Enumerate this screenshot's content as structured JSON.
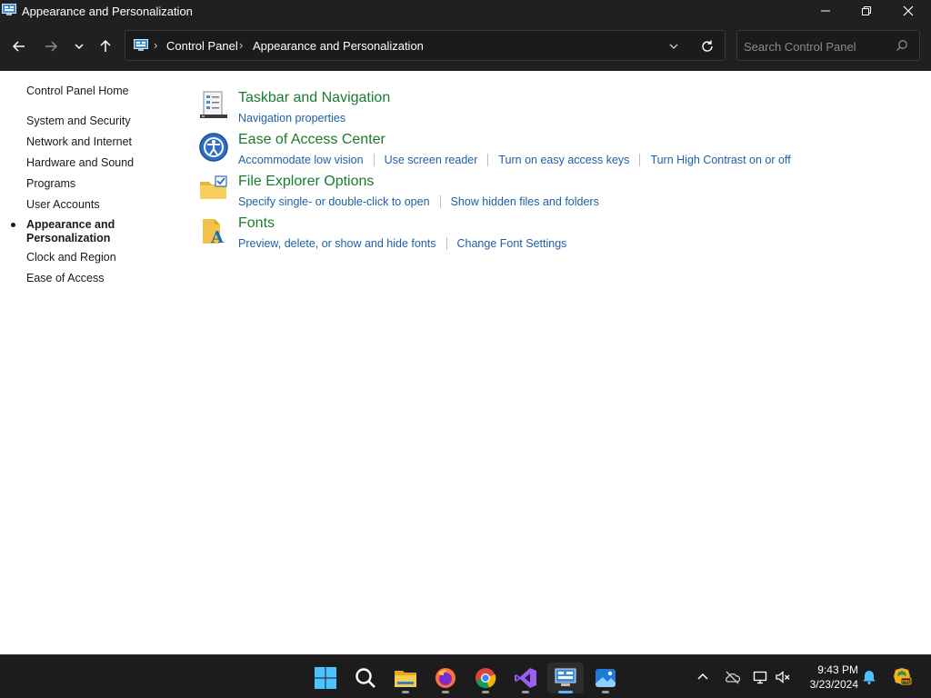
{
  "window": {
    "title": "Appearance and Personalization",
    "controls": [
      "minimize",
      "restore",
      "close"
    ]
  },
  "address_bar": {
    "breadcrumbs": [
      "Control Panel",
      "Appearance and Personalization"
    ],
    "search_placeholder": "Search Control Panel"
  },
  "sidebar": {
    "home": "Control Panel Home",
    "items": [
      {
        "label": "System and Security",
        "active": false
      },
      {
        "label": "Network and Internet",
        "active": false
      },
      {
        "label": "Hardware and Sound",
        "active": false
      },
      {
        "label": "Programs",
        "active": false
      },
      {
        "label": "User Accounts",
        "active": false
      },
      {
        "label": "Appearance and Personalization",
        "active": true
      },
      {
        "label": "Clock and Region",
        "active": false
      },
      {
        "label": "Ease of Access",
        "active": false
      }
    ]
  },
  "categories": [
    {
      "title": "Taskbar and Navigation",
      "icon": "taskbar-icon",
      "links": [
        "Navigation properties"
      ]
    },
    {
      "title": "Ease of Access Center",
      "icon": "ease-of-access-icon",
      "links": [
        "Accommodate low vision",
        "Use screen reader",
        "Turn on easy access keys",
        "Turn High Contrast on or off"
      ]
    },
    {
      "title": "File Explorer Options",
      "icon": "folder-options-icon",
      "links": [
        "Specify single- or double-click to open",
        "Show hidden files and folders"
      ]
    },
    {
      "title": "Fonts",
      "icon": "fonts-icon",
      "links": [
        "Preview, delete, or show and hide fonts",
        "Change Font Settings"
      ]
    }
  ],
  "taskbar": {
    "apps": [
      {
        "name": "start-icon",
        "running": false
      },
      {
        "name": "search-icon",
        "running": false
      },
      {
        "name": "file-explorer-icon",
        "running": true
      },
      {
        "name": "firefox-icon",
        "running": true
      },
      {
        "name": "chrome-icon",
        "running": true
      },
      {
        "name": "visual-studio-icon",
        "running": true
      },
      {
        "name": "control-panel-icon",
        "running": true,
        "active": true
      },
      {
        "name": "photos-icon",
        "running": true
      }
    ],
    "tray": [
      "chevron-up-icon",
      "onedrive-icon",
      "network-icon",
      "volume-muted-icon"
    ],
    "time": "9:43 PM",
    "date": "3/23/2024"
  },
  "colors": {
    "chrome": "#202020",
    "category_title": "#1a7a2e",
    "link": "#1f5fa8",
    "accent": "#5fb2ff"
  }
}
